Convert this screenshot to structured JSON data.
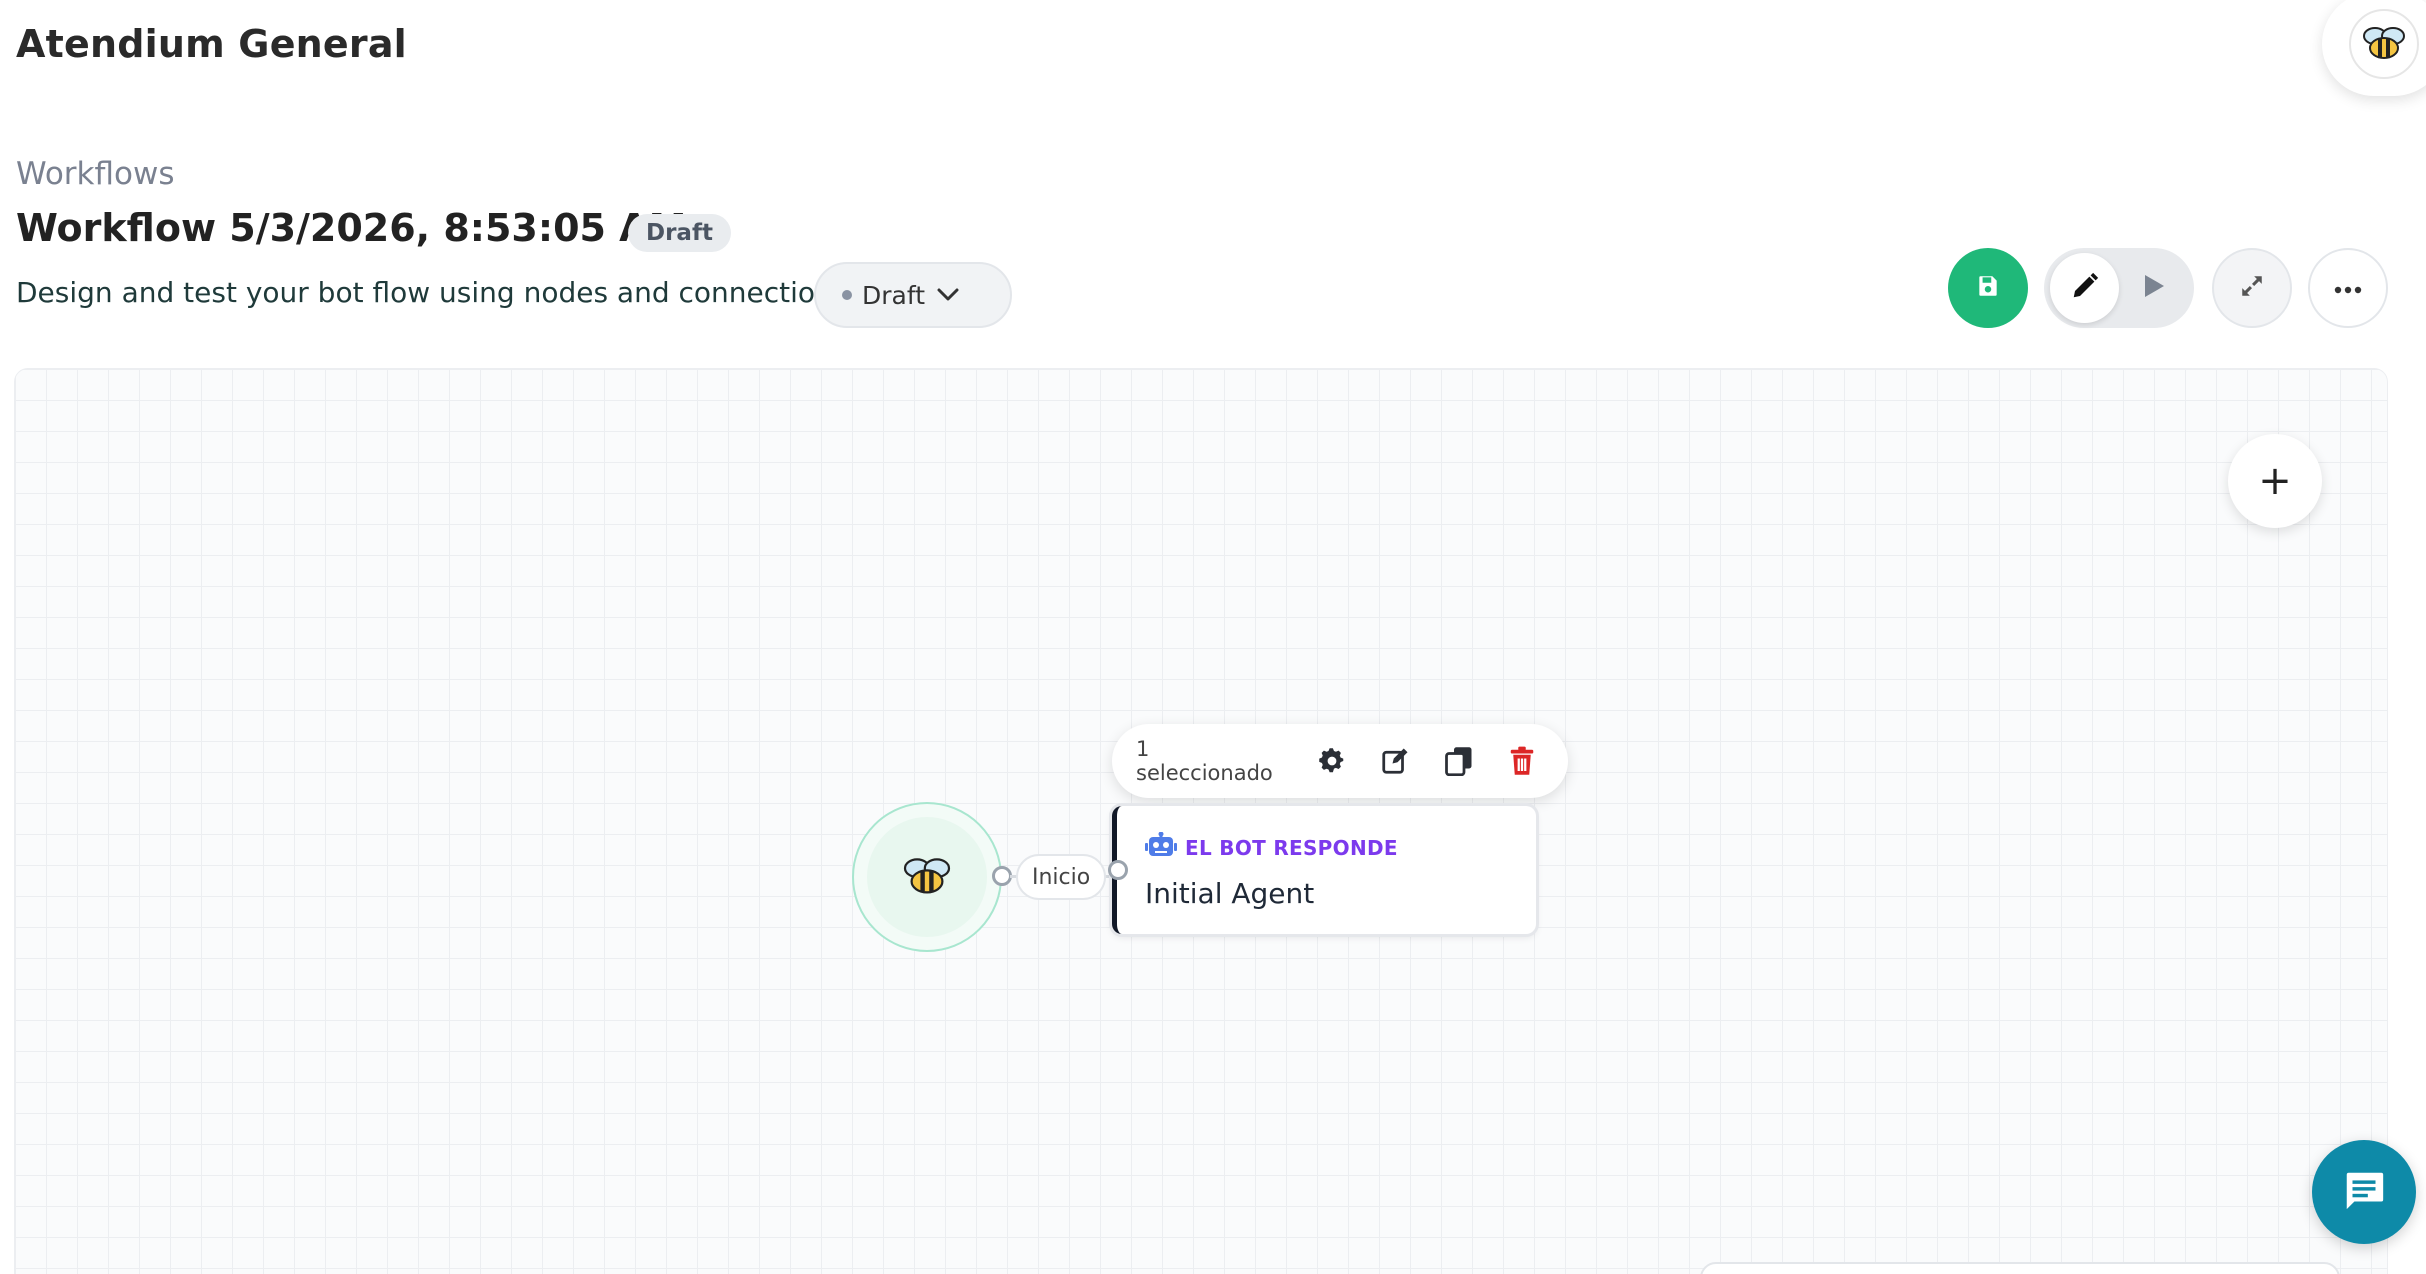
{
  "header": {
    "app_title": "Atendium General"
  },
  "breadcrumb": "Workflows",
  "workflow": {
    "title": "Workflow 5/3/2026, 8:53:05 AM",
    "badge": "Draft",
    "description": "Design and test your bot flow using nodes and connections.",
    "status_selected": "Draft"
  },
  "toolbar_icons": [
    "save-icon",
    "pencil-icon",
    "play-icon",
    "expand-icon",
    "more-icon"
  ],
  "canvas": {
    "add_icon": "+",
    "edge_label": "Inicio",
    "selection_toolbar": {
      "label": "1 seleccionado",
      "icons": [
        "gear-icon",
        "edit-icon",
        "copy-icon",
        "trash-icon"
      ]
    },
    "agent_node": {
      "type_label": "EL BOT RESPONDE",
      "name": "Initial Agent"
    }
  },
  "colors": {
    "save_green": "#1fb879",
    "node_type_purple": "#7c3aed",
    "delete_red": "#dc2626",
    "chat_teal": "#0e8aa8"
  }
}
